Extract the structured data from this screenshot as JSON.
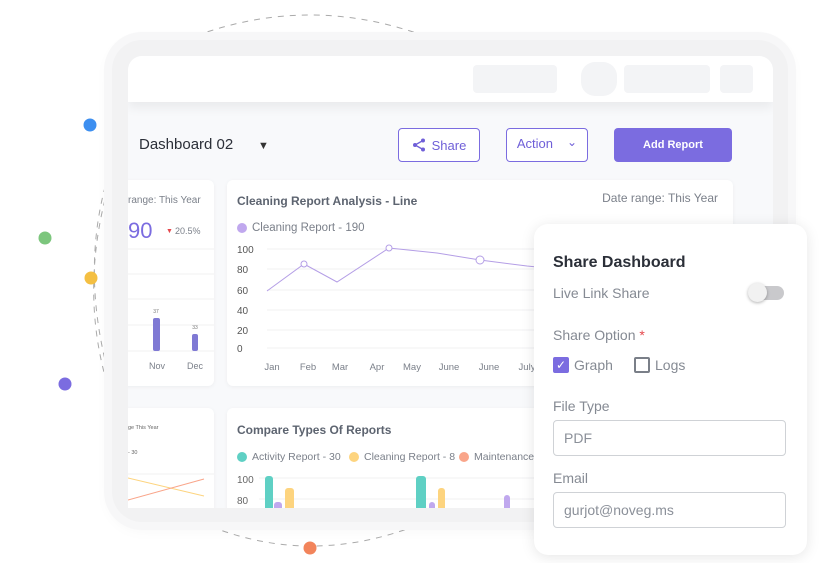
{
  "colors": {
    "accent": "#7b6ce0",
    "line_series": "#b49ee6",
    "activity": "#5fd0c4",
    "cleaning": "#fdd47f",
    "maintenance": "#f9a58a",
    "orbit_dots": [
      "#3d8ff0",
      "#7cc67d",
      "#f4bf42",
      "#7b6ce0",
      "#f2845b"
    ]
  },
  "header": {
    "dashboard_name": "Dashboard 02",
    "dropdown_caret": "▼",
    "share_label": "Share",
    "share_icon": "share-icon",
    "action_label": "Action",
    "action_chevron": "⌄",
    "add_report_label": "Add Report"
  },
  "kpi_card": {
    "date_range": "range: This Year",
    "value": "90",
    "trend_arrow": "▼",
    "change": "20.5%",
    "bar_months": [
      "Nov",
      "Dec"
    ],
    "bar_values": [
      "37",
      "33"
    ]
  },
  "line_card": {
    "title": "Cleaning Report Analysis - Line",
    "date_range": "Date range: This Year",
    "legend": "Cleaning Report - 190"
  },
  "compare_card": {
    "title": "Compare Types Of Reports",
    "legend": [
      {
        "label": "Activity Report - 30",
        "color_key": "activity"
      },
      {
        "label": "Cleaning Report - 8",
        "color_key": "cleaning"
      },
      {
        "label": "Maintenance I",
        "color_key": "maintenance"
      }
    ],
    "y_ticks": [
      "100",
      "80"
    ]
  },
  "small_card": {
    "date_range": "ge This Year",
    "legend": "- 30"
  },
  "share_panel": {
    "title": "Share Dashboard",
    "live_link_label": "Live Link Share",
    "live_link_enabled": false,
    "share_option_label": "Share Option",
    "required_mark": "*",
    "options": [
      {
        "label": "Graph",
        "checked": true
      },
      {
        "label": "Logs",
        "checked": false
      }
    ],
    "file_type_label": "File Type",
    "file_type_value": "PDF",
    "email_label": "Email",
    "email_value": "gurjot@noveg.ms"
  },
  "chart_data": {
    "type": "line",
    "title": "Cleaning Report Analysis - Line",
    "series": [
      {
        "name": "Cleaning Report - 190",
        "values": [
          57,
          84,
          66,
          100,
          95,
          88,
          82,
          79
        ]
      }
    ],
    "categories": [
      "Jan",
      "Feb",
      "Mar",
      "Apr",
      "May",
      "June",
      "June",
      "July"
    ],
    "y_ticks": [
      "100",
      "80",
      "60",
      "40",
      "20",
      "0"
    ],
    "ylim": [
      0,
      100
    ],
    "grid": true,
    "xlabel": "",
    "ylabel": ""
  }
}
